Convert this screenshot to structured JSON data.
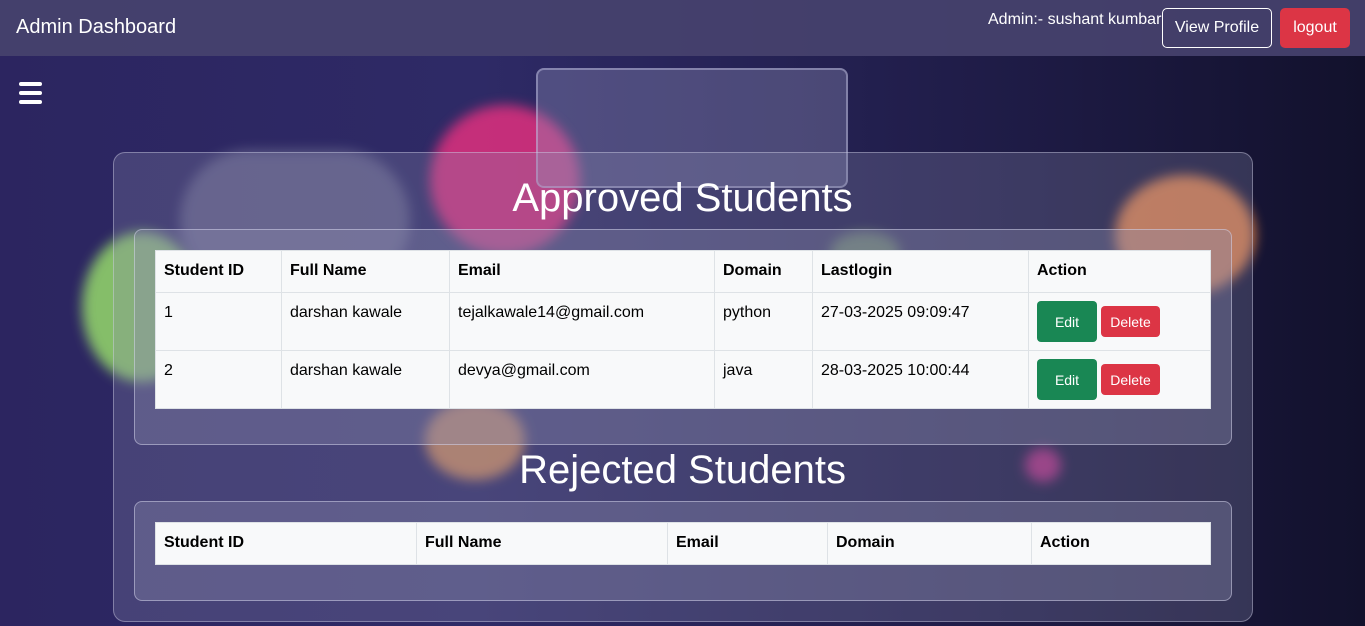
{
  "navbar": {
    "brand": "Admin Dashboard",
    "admin_label": "Admin:- sushant kumbar",
    "view_profile_label": "View Profile",
    "logout_label": "logout"
  },
  "approved": {
    "title": "Approved Students",
    "columns": [
      "Student ID",
      "Full Name",
      "Email",
      "Domain",
      "Lastlogin",
      "Action"
    ],
    "rows": [
      {
        "id": "1",
        "name": "darshan kawale",
        "email": "tejalkawale14@gmail.com",
        "domain": "python",
        "lastlogin": "27-03-2025 09:09:47",
        "edit": "Edit",
        "delete": "Delete"
      },
      {
        "id": "2",
        "name": "darshan kawale",
        "email": "devya@gmail.com",
        "domain": "java",
        "lastlogin": "28-03-2025 10:00:44",
        "edit": "Edit",
        "delete": "Delete"
      }
    ]
  },
  "rejected": {
    "title": "Rejected Students",
    "columns": [
      "Student ID",
      "Full Name",
      "Email",
      "Domain",
      "Action"
    ],
    "rows": []
  },
  "icons": {
    "menu": "hamburger-menu-icon"
  },
  "colors": {
    "edit": "#198754",
    "delete": "#dc3545",
    "logout": "#dc3545"
  }
}
